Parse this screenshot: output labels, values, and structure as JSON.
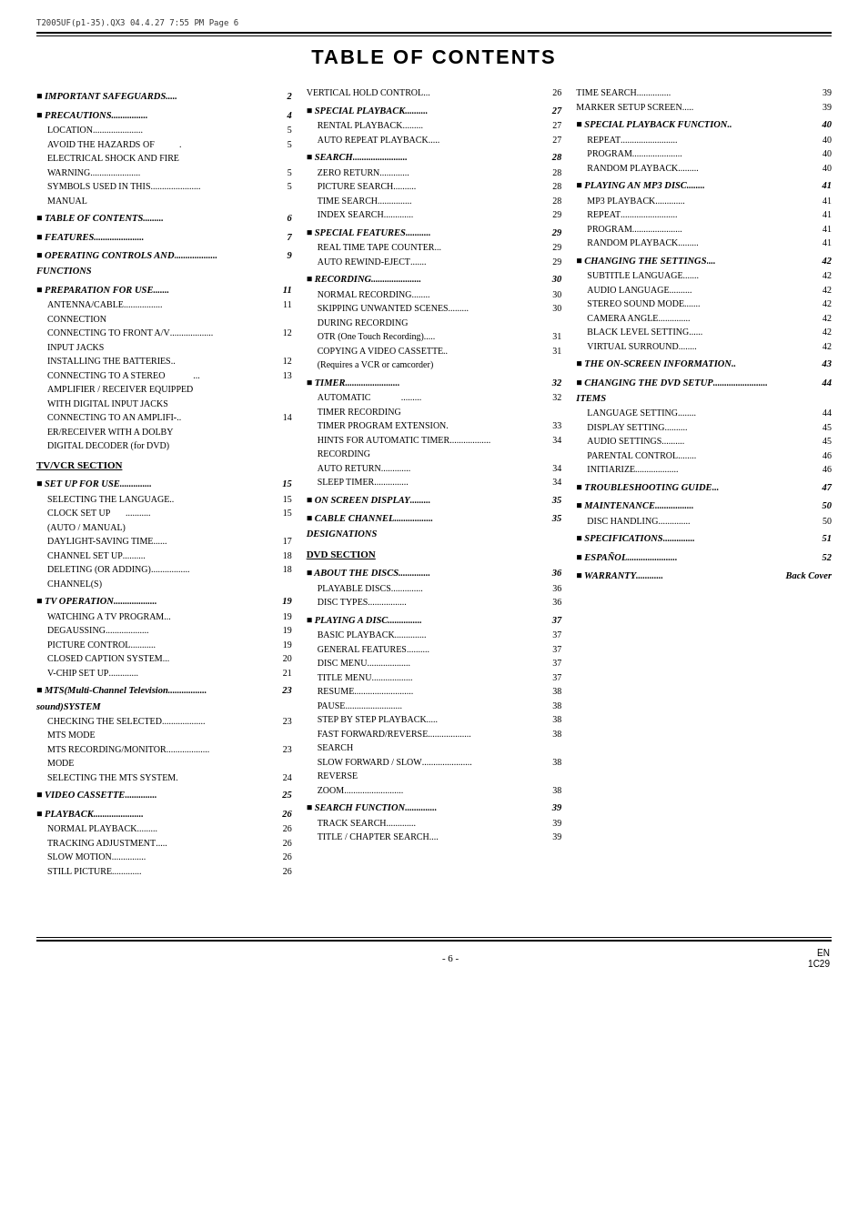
{
  "header": {
    "file_info": "T2005UF(p1-35).QX3  04.4.27  7:55 PM  Page 6"
  },
  "title": "TABLE OF CONTENTS",
  "columns": [
    {
      "id": "col1",
      "sections": [
        {
          "type": "section-header",
          "bullet": true,
          "text": "IMPORTANT SAFEGUARDS",
          "dots": ".....",
          "page": "2"
        },
        {
          "type": "section-header",
          "bullet": true,
          "text": "PRECAUTIONS",
          "dots": "................",
          "page": "4"
        },
        {
          "type": "sub-entries",
          "items": [
            {
              "text": "LOCATION",
              "dots": "......................",
              "page": "5"
            },
            {
              "text": "AVOID THE HAZARDS OF\nELECTRICAL SHOCK AND FIRE",
              "dots": ".",
              "page": "5"
            },
            {
              "text": "WARNING",
              "dots": "......................",
              "page": "5"
            },
            {
              "text": "SYMBOLS USED IN THIS\nMANUAL",
              "dots": "......................",
              "page": "5"
            }
          ]
        },
        {
          "type": "section-header",
          "bullet": true,
          "text": "TABLE OF CONTENTS",
          "dots": ".........",
          "page": "6"
        },
        {
          "type": "section-header",
          "bullet": true,
          "text": "FEATURES",
          "dots": "......................",
          "page": "7"
        },
        {
          "type": "section-header",
          "bullet": true,
          "text": "OPERATING CONTROLS AND\nFUNCTIONS",
          "dots": "...................",
          "page": "9"
        },
        {
          "type": "section-header",
          "bullet": true,
          "text": "PREPARATION FOR USE",
          "dots": ".......",
          "page": "11"
        },
        {
          "type": "sub-entries",
          "items": [
            {
              "text": "ANTENNA/CABLE\nCONNECTION",
              "dots": ".................",
              "page": "11"
            },
            {
              "text": "CONNECTING TO FRONT A/V\nINPUT JACKS",
              "dots": "...................",
              "page": "12"
            },
            {
              "text": "INSTALLING THE BATTERIES",
              "dots": "..",
              "page": "12"
            },
            {
              "text": "CONNECTING TO A STEREO\nAMPLIFIER / RECEIVER EQUIPPED\nWITH DIGITAL INPUT JACKS",
              "dots": "...",
              "page": "13"
            },
            {
              "text": "CONNECTING TO AN AMPLIFI-\nER/RECEIVER WITH A DOLBY\nDIGITAL DECODER (for DVD)",
              "dots": "..",
              "page": "14"
            }
          ]
        },
        {
          "type": "sub-section-header",
          "text": "TV/VCR SECTION"
        },
        {
          "type": "section-header",
          "bullet": true,
          "text": "SET UP FOR USE",
          "dots": "..............",
          "page": "15"
        },
        {
          "type": "sub-entries",
          "items": [
            {
              "text": "SELECTING THE LANGUAGE",
              "dots": "..",
              "page": "15"
            },
            {
              "text": "CLOCK SET UP\n(AUTO / MANUAL)",
              "dots": "...........",
              "page": "15"
            },
            {
              "text": "DAYLIGHT-SAVING TIME",
              "dots": "......",
              "page": "17"
            },
            {
              "text": "CHANNEL SET UP",
              "dots": "..........",
              "page": "18"
            },
            {
              "text": "DELETING (OR ADDING)\nCHANNEL(S)",
              "dots": ".................",
              "page": "18"
            }
          ]
        },
        {
          "type": "section-header",
          "bullet": true,
          "text": "TV OPERATION",
          "dots": "...................",
          "page": "19"
        },
        {
          "type": "sub-entries",
          "items": [
            {
              "text": "WATCHING A TV PROGRAM",
              "dots": "...",
              "page": "19"
            },
            {
              "text": "DEGAUSSING",
              "dots": "...................",
              "page": "19"
            },
            {
              "text": "PICTURE CONTROL",
              "dots": "...........",
              "page": "19"
            },
            {
              "text": "CLOSED CAPTION SYSTEM",
              "dots": "...",
              "page": "20"
            },
            {
              "text": "V-CHIP SET UP",
              "dots": ".............",
              "page": "21"
            }
          ]
        },
        {
          "type": "section-header",
          "bullet": true,
          "text": "MTS(Multi-Channel Television\nsound)SYSTEM",
          "dots": ".................",
          "page": "23"
        },
        {
          "type": "sub-entries",
          "items": [
            {
              "text": "CHECKING THE SELECTED\nMTS MODE",
              "dots": "...................",
              "page": "23"
            },
            {
              "text": "MTS RECORDING/MONITOR\nMODE",
              "dots": "...................",
              "page": "23"
            },
            {
              "text": "SELECTING THE MTS SYSTEM",
              "dots": ".",
              "page": "24"
            }
          ]
        },
        {
          "type": "section-header",
          "bullet": true,
          "text": "VIDEO CASSETTE",
          "dots": "..............",
          "page": "25"
        },
        {
          "type": "section-header",
          "bullet": true,
          "text": "PLAYBACK",
          "dots": "......................",
          "page": "26"
        },
        {
          "type": "sub-entries",
          "items": [
            {
              "text": "NORMAL PLAYBACK",
              "dots": ".........",
              "page": "26"
            },
            {
              "text": "TRACKING ADJUSTMENT",
              "dots": ".....",
              "page": "26"
            },
            {
              "text": "SLOW MOTION",
              "dots": "...............",
              "page": "26"
            },
            {
              "text": "STILL PICTURE",
              "dots": ".............",
              "page": "26"
            }
          ]
        }
      ]
    },
    {
      "id": "col2",
      "sections": [
        {
          "type": "plain-entry",
          "text": "VERTICAL HOLD CONTROL",
          "dots": "...",
          "page": "26"
        },
        {
          "type": "section-header",
          "bullet": true,
          "text": "SPECIAL PLAYBACK",
          "dots": "..........",
          "page": "27"
        },
        {
          "type": "sub-entries",
          "items": [
            {
              "text": "RENTAL PLAYBACK",
              "dots": ".........",
              "page": "27"
            },
            {
              "text": "AUTO REPEAT PLAYBACK",
              "dots": ".....",
              "page": "27"
            }
          ]
        },
        {
          "type": "section-header",
          "bullet": true,
          "text": "SEARCH",
          "dots": "........................",
          "page": "28"
        },
        {
          "type": "sub-entries",
          "items": [
            {
              "text": "ZERO RETURN",
              "dots": ".............",
              "page": "28"
            },
            {
              "text": "PICTURE SEARCH",
              "dots": "..........",
              "page": "28"
            },
            {
              "text": "TIME SEARCH",
              "dots": "...............",
              "page": "28"
            },
            {
              "text": "INDEX SEARCH",
              "dots": ".............",
              "page": "29"
            }
          ]
        },
        {
          "type": "section-header",
          "bullet": true,
          "text": "SPECIAL FEATURES",
          "dots": "...........",
          "page": "29"
        },
        {
          "type": "sub-entries",
          "items": [
            {
              "text": "REAL TIME TAPE COUNTER",
              "dots": "...",
              "page": "29"
            },
            {
              "text": "AUTO REWIND-EJECT",
              "dots": ".......",
              "page": "29"
            }
          ]
        },
        {
          "type": "section-header",
          "bullet": true,
          "text": "RECORDING",
          "dots": "......................",
          "page": "30"
        },
        {
          "type": "sub-entries",
          "items": [
            {
              "text": "NORMAL RECORDING",
              "dots": "........",
              "page": "30"
            },
            {
              "text": "SKIPPING UNWANTED SCENES\nDURING RECORDING",
              "dots": ".........",
              "page": "30"
            },
            {
              "text": "OTR (One Touch Recording)",
              "dots": ".....",
              "page": "31"
            },
            {
              "text": "COPYING A VIDEO CASSETTE\n(Requires a VCR or camcorder)",
              "dots": "..",
              "page": "31"
            }
          ]
        },
        {
          "type": "section-header",
          "bullet": true,
          "text": "TIMER",
          "dots": "........................",
          "page": "32"
        },
        {
          "type": "sub-entries",
          "items": [
            {
              "text": "AUTOMATIC\nTIMER RECORDING",
              "dots": ".........",
              "page": "32"
            },
            {
              "text": "TIMER PROGRAM EXTENSION",
              "dots": ".",
              "page": "33"
            },
            {
              "text": "HINTS FOR AUTOMATIC TIMER\nRECORDING",
              "dots": "..................",
              "page": "34"
            },
            {
              "text": "AUTO RETURN",
              "dots": ".............",
              "page": "34"
            },
            {
              "text": "SLEEP TIMER",
              "dots": "...............",
              "page": "34"
            }
          ]
        },
        {
          "type": "section-header",
          "bullet": true,
          "text": "ON SCREEN DISPLAY",
          "dots": ".........",
          "page": "35"
        },
        {
          "type": "section-header",
          "bullet": true,
          "text": "CABLE CHANNEL\nDESIGNATIONS",
          "dots": ".................",
          "page": "35"
        },
        {
          "type": "sub-section-header",
          "text": "DVD SECTION"
        },
        {
          "type": "section-header",
          "bullet": true,
          "text": "ABOUT THE DISCS",
          "dots": "..............",
          "page": "36"
        },
        {
          "type": "sub-entries",
          "items": [
            {
              "text": "PLAYABLE DISCS",
              "dots": "..............",
              "page": "36"
            },
            {
              "text": "DISC TYPES",
              "dots": ".................",
              "page": "36"
            }
          ]
        },
        {
          "type": "section-header",
          "bullet": true,
          "text": "PLAYING A DISC",
          "dots": "...............",
          "page": "37"
        },
        {
          "type": "sub-entries",
          "items": [
            {
              "text": "BASIC PLAYBACK",
              "dots": "..............",
              "page": "37"
            },
            {
              "text": "GENERAL FEATURES",
              "dots": "..........",
              "page": "37"
            },
            {
              "text": "DISC MENU",
              "dots": "...................",
              "page": "37"
            },
            {
              "text": "TITLE MENU",
              "dots": "..................",
              "page": "37"
            },
            {
              "text": "RESUME",
              "dots": "..........................",
              "page": "38"
            },
            {
              "text": "PAUSE",
              "dots": ".........................",
              "page": "38"
            },
            {
              "text": "STEP BY STEP PLAYBACK",
              "dots": ".....",
              "page": "38"
            },
            {
              "text": "FAST FORWARD/REVERSE\nSEARCH",
              "dots": "...................",
              "page": "38"
            },
            {
              "text": "SLOW FORWARD / SLOW\nREVERSE",
              "dots": "......................",
              "page": "38"
            },
            {
              "text": "ZOOM",
              "dots": "..........................",
              "page": "38"
            }
          ]
        },
        {
          "type": "section-header",
          "bullet": true,
          "text": "SEARCH FUNCTION",
          "dots": "..............",
          "page": "39"
        },
        {
          "type": "sub-entries",
          "items": [
            {
              "text": "TRACK SEARCH",
              "dots": ".............",
              "page": "39"
            },
            {
              "text": "TITLE / CHAPTER SEARCH",
              "dots": "....",
              "page": "39"
            }
          ]
        }
      ]
    },
    {
      "id": "col3",
      "sections": [
        {
          "type": "plain-entry",
          "text": "TIME SEARCH",
          "dots": "...............",
          "page": "39"
        },
        {
          "type": "plain-entry",
          "text": "MARKER SETUP SCREEN",
          "dots": ".....",
          "page": "39"
        },
        {
          "type": "section-header",
          "bullet": true,
          "text": "SPECIAL PLAYBACK FUNCTION",
          "dots": "..",
          "page": "40"
        },
        {
          "type": "sub-entries",
          "items": [
            {
              "text": "REPEAT",
              "dots": ".........................",
              "page": "40"
            },
            {
              "text": "PROGRAM",
              "dots": "......................",
              "page": "40"
            },
            {
              "text": "RANDOM PLAYBACK",
              "dots": ".........",
              "page": "40"
            }
          ]
        },
        {
          "type": "section-header",
          "bullet": true,
          "text": "PLAYING AN MP3 DISC",
          "dots": "........",
          "page": "41"
        },
        {
          "type": "sub-entries",
          "items": [
            {
              "text": "MP3 PLAYBACK",
              "dots": ".............",
              "page": "41"
            },
            {
              "text": "REPEAT",
              "dots": ".........................",
              "page": "41"
            },
            {
              "text": "PROGRAM",
              "dots": "......................",
              "page": "41"
            },
            {
              "text": "RANDOM PLAYBACK",
              "dots": ".........",
              "page": "41"
            }
          ]
        },
        {
          "type": "section-header",
          "bullet": true,
          "text": "CHANGING THE SETTINGS",
          "dots": "....",
          "page": "42"
        },
        {
          "type": "sub-entries",
          "items": [
            {
              "text": "SUBTITLE LANGUAGE",
              "dots": ".......",
              "page": "42"
            },
            {
              "text": "AUDIO LANGUAGE",
              "dots": "..........",
              "page": "42"
            },
            {
              "text": "STEREO SOUND MODE",
              "dots": ".......",
              "page": "42"
            },
            {
              "text": "CAMERA ANGLE",
              "dots": "..............",
              "page": "42"
            },
            {
              "text": "BLACK LEVEL SETTING",
              "dots": "......",
              "page": "42"
            },
            {
              "text": "VIRTUAL SURROUND",
              "dots": "........",
              "page": "42"
            }
          ]
        },
        {
          "type": "section-header",
          "bullet": true,
          "text": "THE ON-SCREEN INFORMATION",
          "dots": "..",
          "page": "43"
        },
        {
          "type": "section-header",
          "bullet": true,
          "text": "CHANGING THE DVD SETUP\nITEMS",
          "dots": "........................",
          "page": "44"
        },
        {
          "type": "sub-entries",
          "items": [
            {
              "text": "LANGUAGE SETTING",
              "dots": "........",
              "page": "44"
            },
            {
              "text": "DISPLAY SETTING",
              "dots": "..........",
              "page": "45"
            },
            {
              "text": "AUDIO SETTINGS",
              "dots": "..........",
              "page": "45"
            },
            {
              "text": "PARENTAL CONTROL",
              "dots": "........",
              "page": "46"
            },
            {
              "text": "INITIARIZE",
              "dots": "...................",
              "page": "46"
            }
          ]
        },
        {
          "type": "section-header",
          "bullet": true,
          "text": "TROUBLESHOOTING GUIDE",
          "dots": "...",
          "page": "47"
        },
        {
          "type": "section-header",
          "bullet": true,
          "text": "MAINTENANCE",
          "dots": ".................",
          "page": "50"
        },
        {
          "type": "sub-entries",
          "items": [
            {
              "text": "DISC HANDLING",
              "dots": "..............",
              "page": "50"
            }
          ]
        },
        {
          "type": "section-header",
          "bullet": true,
          "text": "SPECIFICATIONS",
          "dots": "..............",
          "page": "51"
        },
        {
          "type": "section-header",
          "bullet": true,
          "text": "ESPAÑOL",
          "dots": "......................",
          "page": "52"
        },
        {
          "type": "section-header",
          "bullet": true,
          "text": "WARRANTY",
          "dots": "............",
          "page": "Back Cover"
        }
      ]
    }
  ],
  "footer": {
    "page_indicator": "- 6 -",
    "lang": "EN",
    "model": "1C29"
  }
}
